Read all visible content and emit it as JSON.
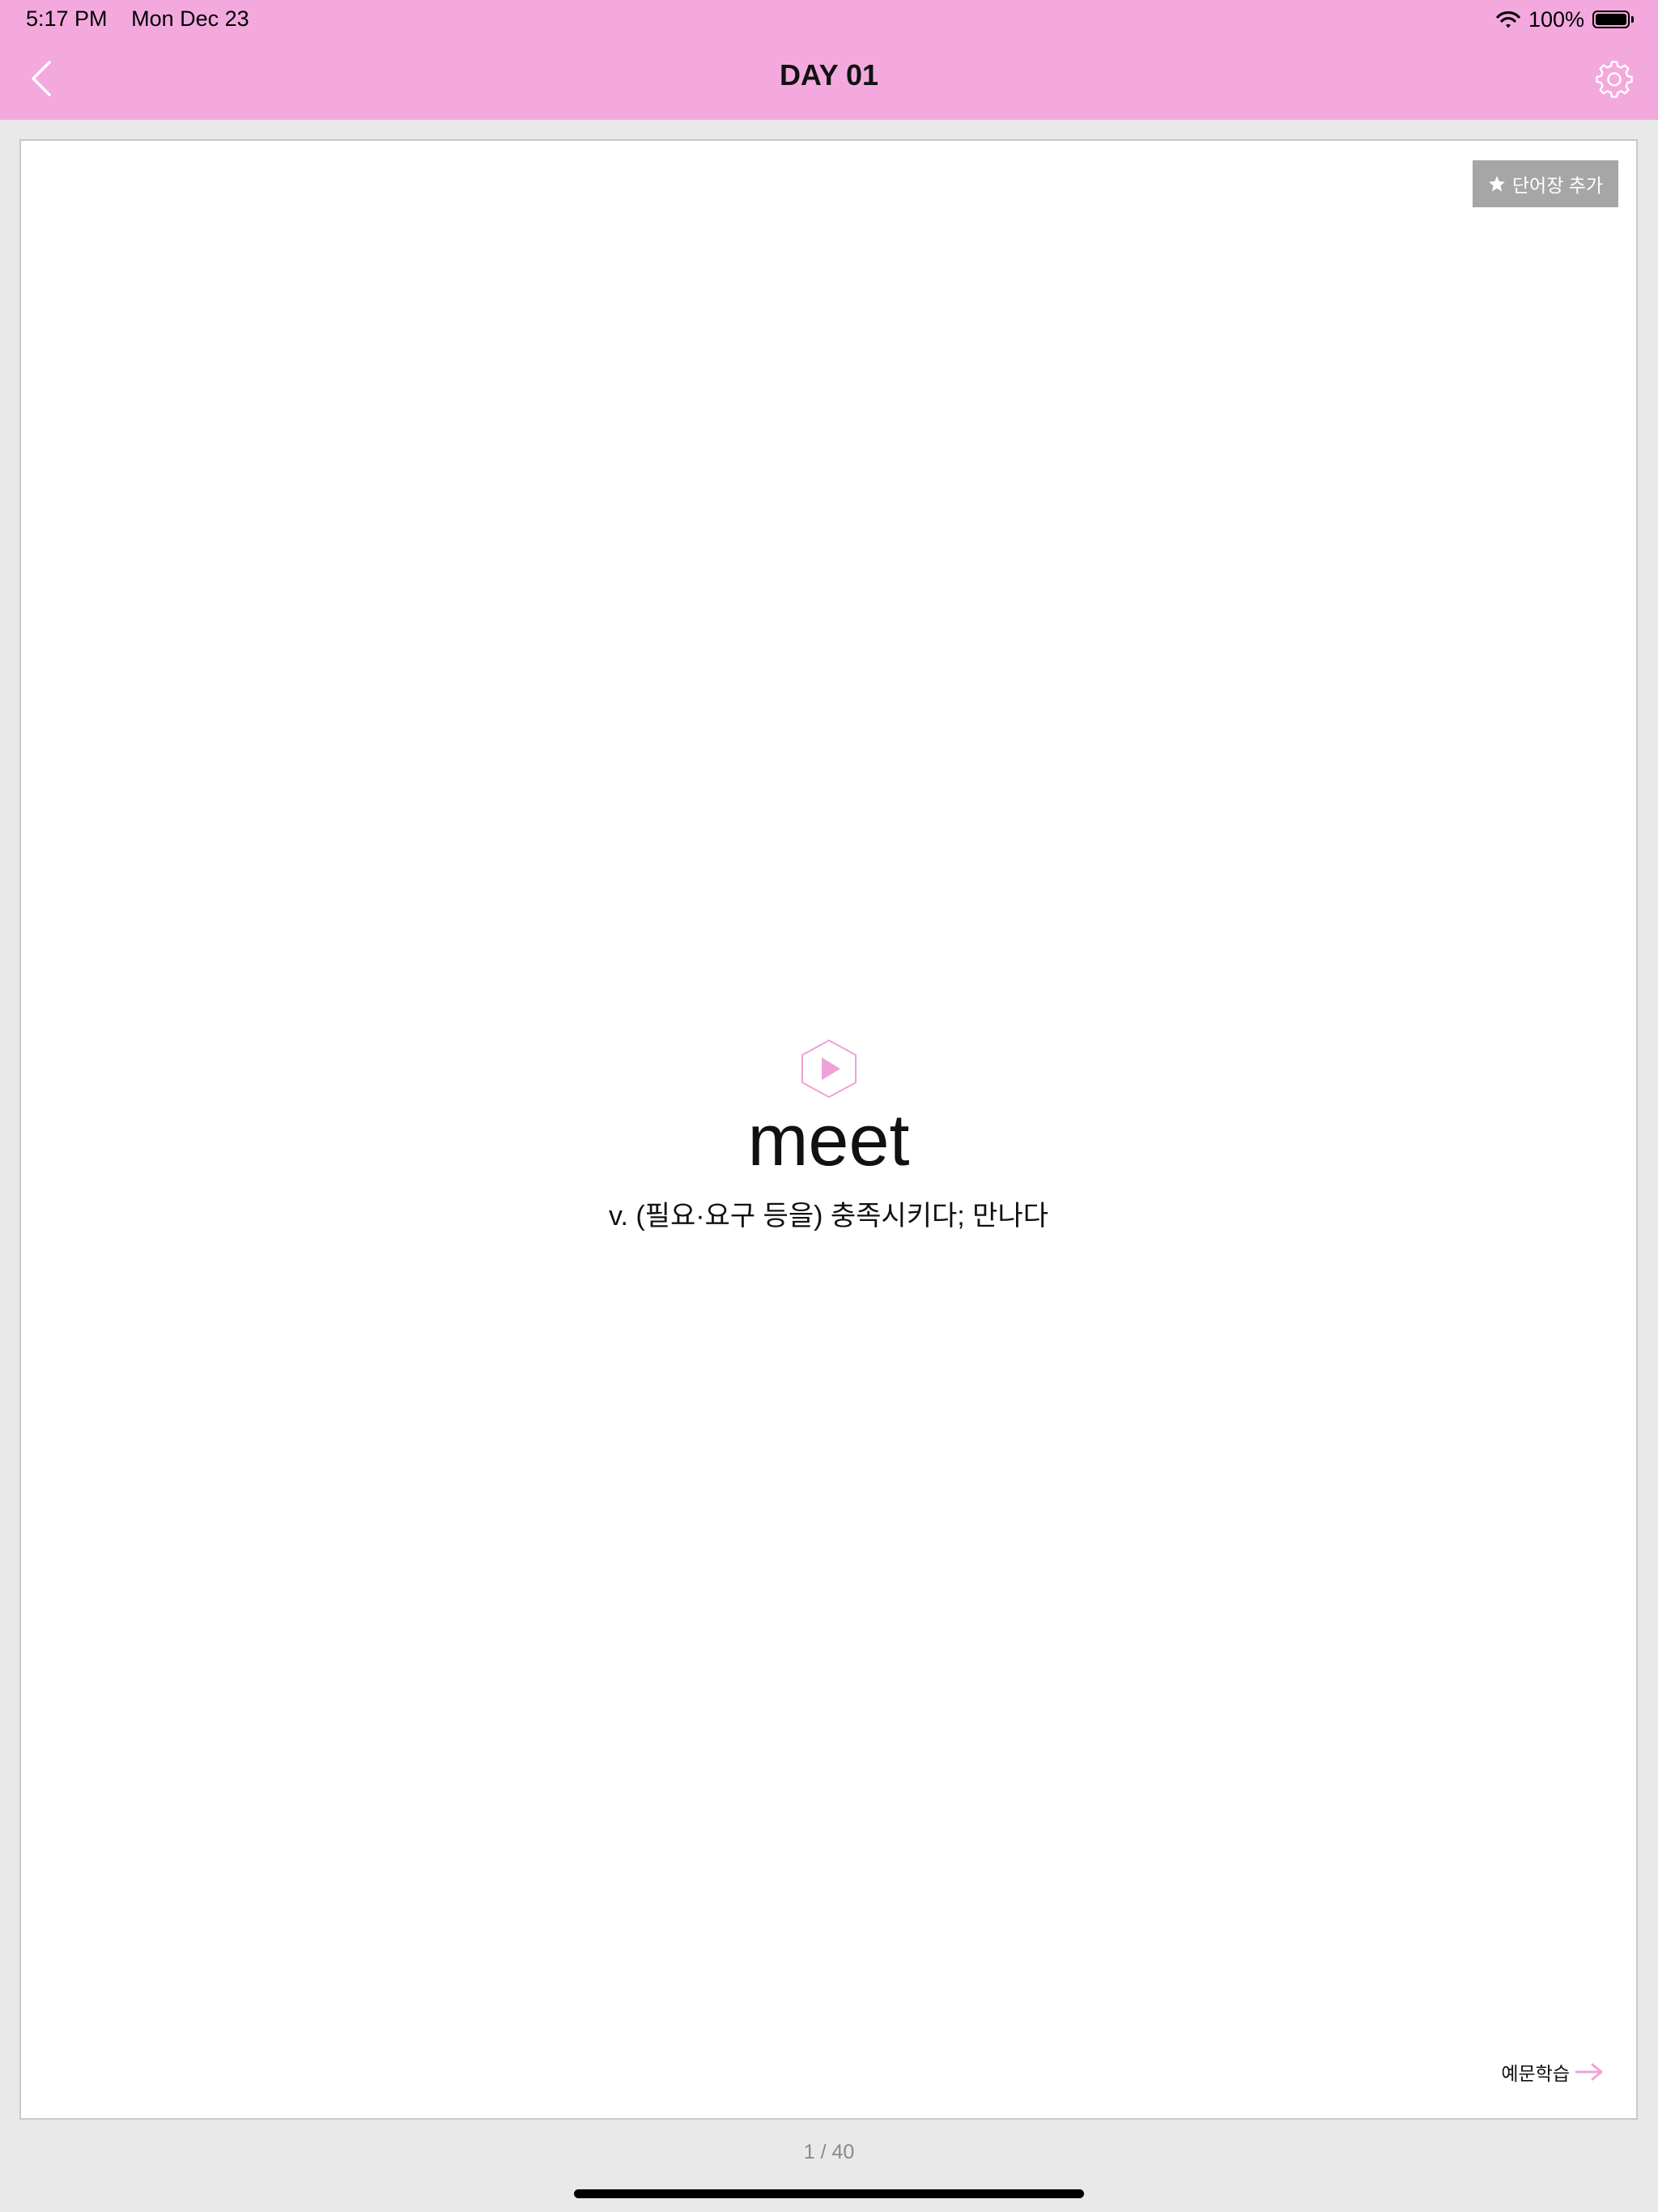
{
  "status_bar": {
    "time": "5:17 PM",
    "date": "Mon Dec 23",
    "battery": "100%",
    "battery_level": 1.0
  },
  "nav": {
    "title": "DAY 01",
    "back_icon": "chevron-left-icon",
    "settings_icon": "gear-icon"
  },
  "card": {
    "add_button_label": "단어장 추가",
    "add_button_icon": "star-icon",
    "word": "meet",
    "meaning": "v. (필요·요구 등을) 충족시키다; 만나다",
    "play_icon": "play-hexagon-icon",
    "example_label": "예문학습",
    "example_icon": "arrow-right-icon"
  },
  "pager": {
    "text": "1 / 40"
  },
  "colors": {
    "header_bg": "#f3a9de",
    "accent": "#eea3d8",
    "page_bg": "#e9e9e9",
    "button_gray": "#a6a6a6"
  }
}
